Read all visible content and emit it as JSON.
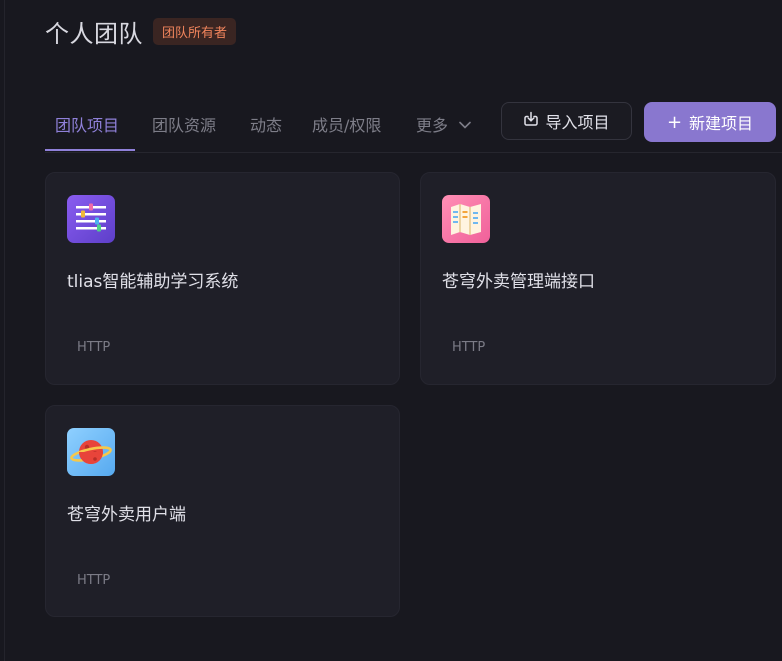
{
  "team": {
    "title": "个人团队",
    "badge": "团队所有者"
  },
  "tabs": [
    {
      "label": "团队项目",
      "active": true
    },
    {
      "label": "团队资源",
      "active": false
    },
    {
      "label": "动态",
      "active": false
    },
    {
      "label": "成员/权限",
      "active": false
    },
    {
      "label": "更多",
      "active": false
    }
  ],
  "actions": {
    "import_label": "导入项目",
    "new_label": "新建项目"
  },
  "projects": [
    {
      "title": "tlias智能辅助学习系统",
      "type": "HTTP",
      "icon": "list-settings-icon"
    },
    {
      "title": "苍穹外卖管理端接口",
      "type": "HTTP",
      "icon": "map-icon"
    },
    {
      "title": "苍穹外卖用户端",
      "type": "HTTP",
      "icon": "planet-icon"
    }
  ],
  "colors": {
    "background": "#18181f",
    "card": "#1f1f28",
    "accent": "#8977cf",
    "badge_text": "#f0845c"
  }
}
